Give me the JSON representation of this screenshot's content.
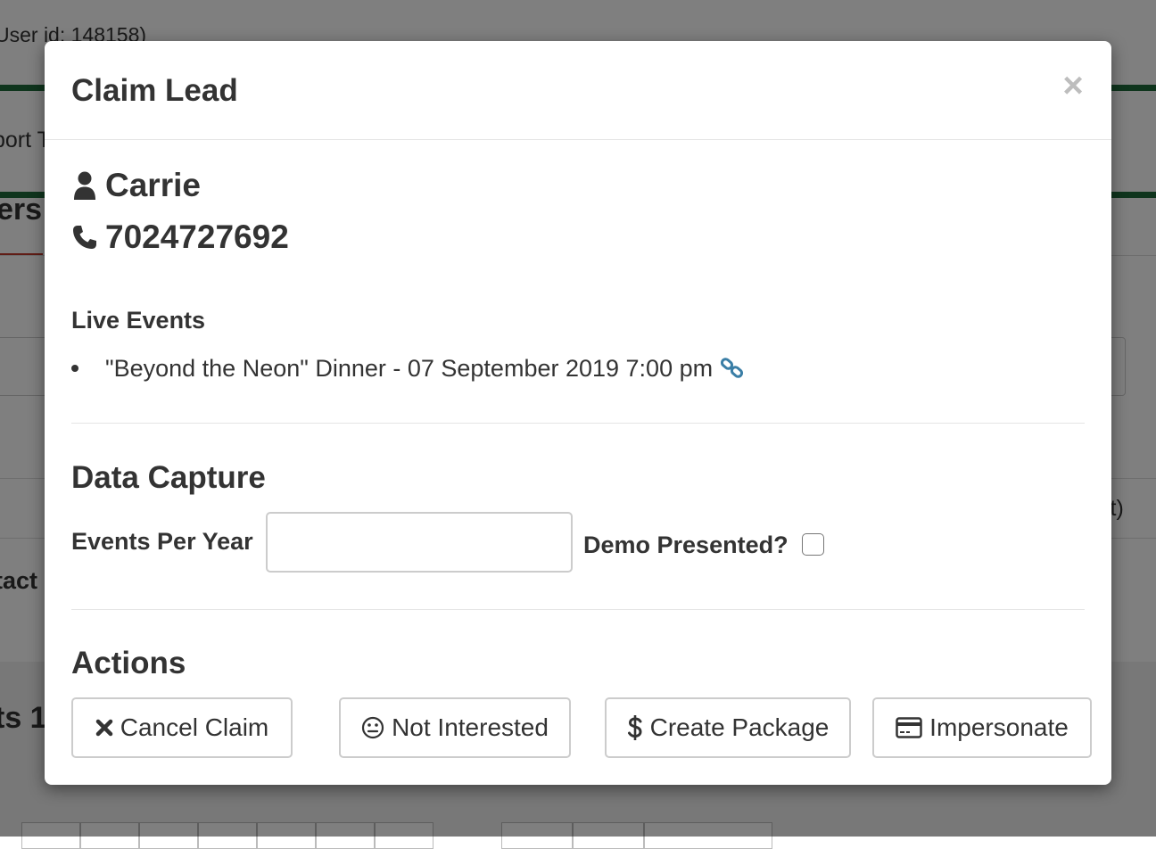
{
  "background": {
    "user_id_text": "User id: 148158)",
    "nav_text": "port T",
    "heading_text": "ers",
    "contact_text": "tact",
    "right_text": "st)",
    "section_text": "ts 1"
  },
  "modal": {
    "title": "Claim Lead",
    "close_label": "×",
    "contact": {
      "name": "Carrie",
      "phone": "7024727692",
      "name_icon": "user-icon",
      "phone_icon": "phone-icon"
    },
    "live_events": {
      "label": "Live Events",
      "items": [
        {
          "text": "\"Beyond the Neon\" Dinner - 07 September 2019 7:00 pm",
          "icon": "link-icon"
        }
      ]
    },
    "data_capture": {
      "heading": "Data Capture",
      "events_per_year_label": "Events Per Year",
      "events_per_year_value": "",
      "demo_presented_label": "Demo Presented?",
      "demo_presented_checked": false
    },
    "actions": {
      "heading": "Actions",
      "buttons": [
        {
          "label": "Cancel Claim",
          "icon": "times-icon"
        },
        {
          "label": "Not Interested",
          "icon": "meh-face-icon"
        },
        {
          "label": "Create Package",
          "icon": "dollar-icon"
        },
        {
          "label": "Impersonate",
          "icon": "credit-card-icon"
        }
      ]
    }
  },
  "colors": {
    "accent_link": "#3a7ea6",
    "green_bar": "#1e6b3b",
    "text": "#333333"
  }
}
